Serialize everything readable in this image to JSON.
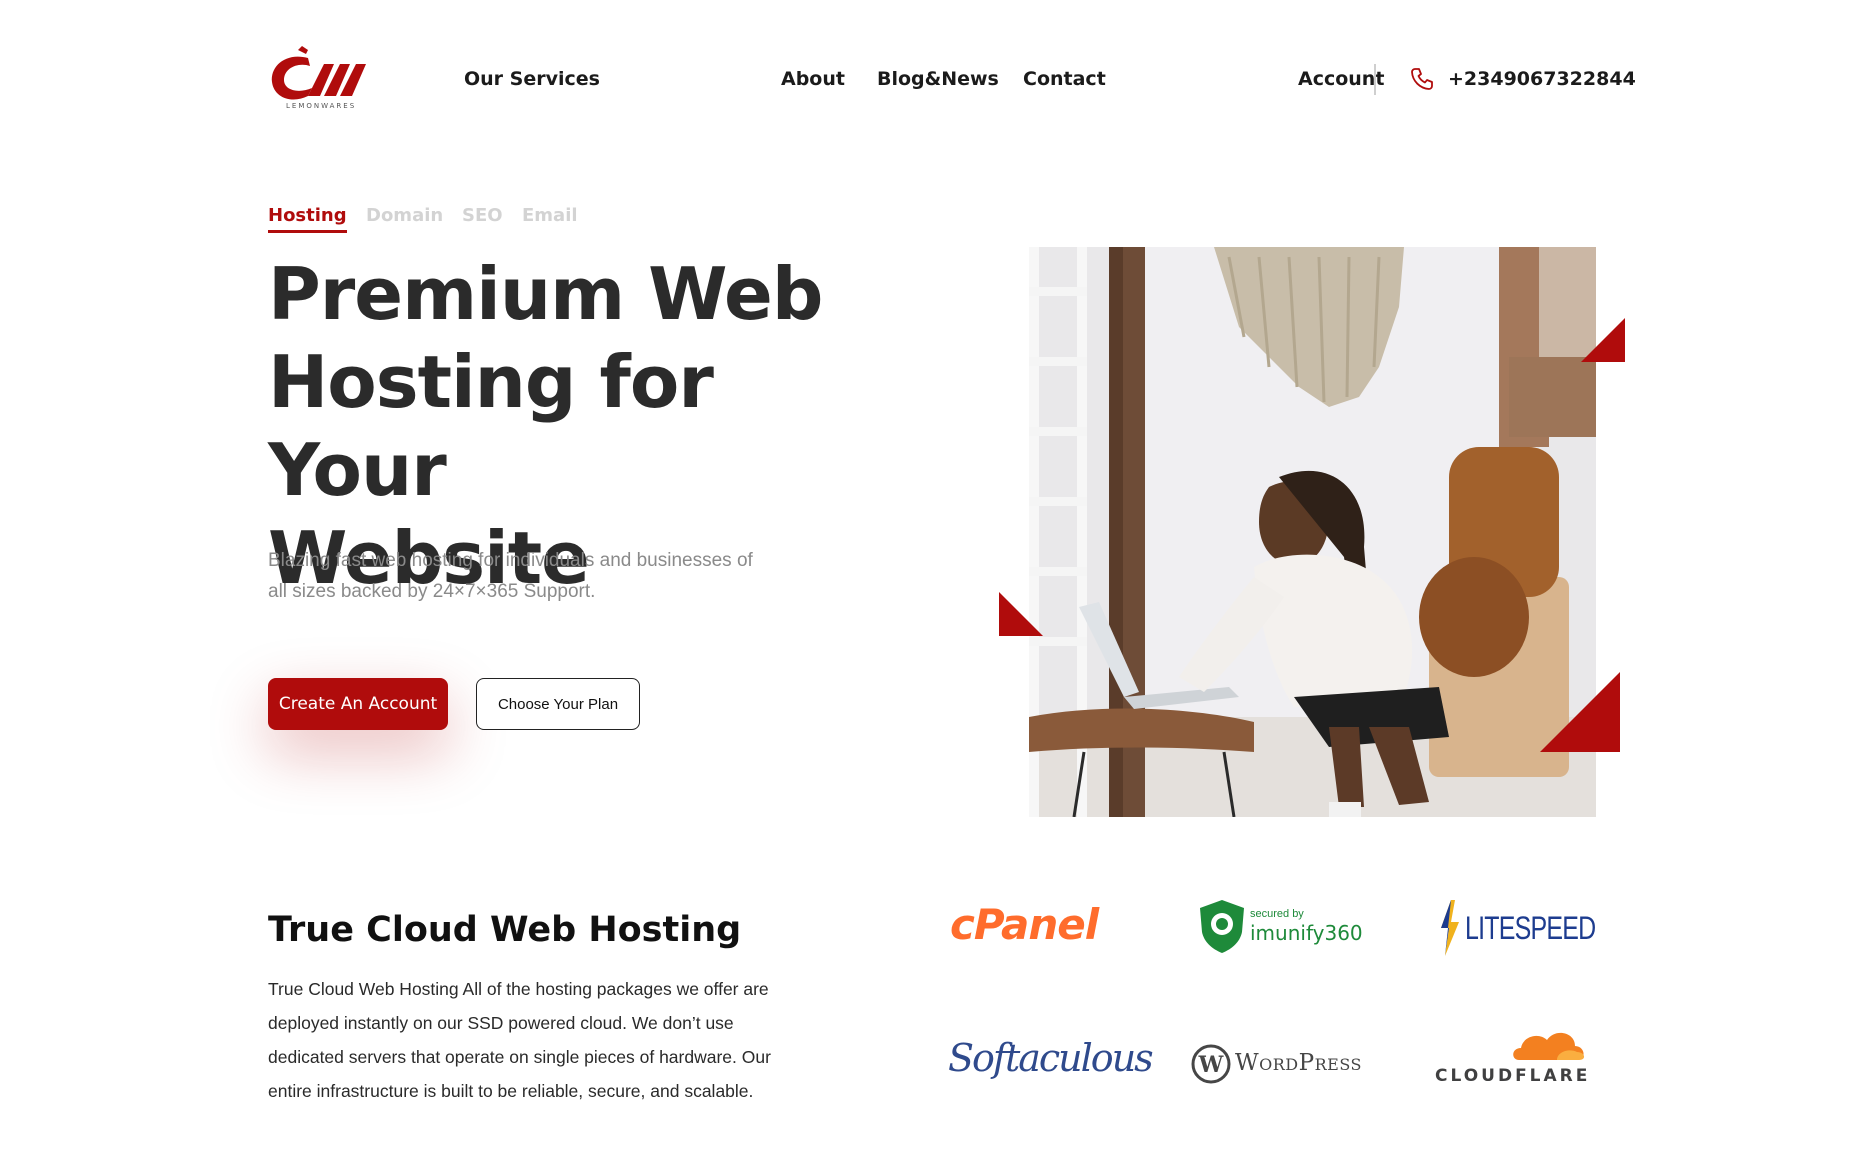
{
  "header": {
    "logo_text": "LEMONWARES",
    "nav": {
      "services": "Our Services",
      "about": "About",
      "blog": "Blog&News",
      "contact": "Contact",
      "account": "Account",
      "phone": "+2349067322844"
    }
  },
  "tabs": [
    {
      "label": "Hosting",
      "active": true
    },
    {
      "label": "Domain",
      "active": false
    },
    {
      "label": "SEO",
      "active": false
    },
    {
      "label": "Email",
      "active": false
    }
  ],
  "hero": {
    "title_line1": "Premium Web",
    "title_line2": "Hosting for Your",
    "title_line3": "Website",
    "subtitle_line1": "Blazing fast web hosting for individuals and businesses of",
    "subtitle_line2": "all sizes backed by 24×7×365 Support.",
    "primary_button": "Create An Account",
    "secondary_button": "Choose Your Plan"
  },
  "cloud_section": {
    "title": "True Cloud Web Hosting",
    "body_line1": "True Cloud Web Hosting All of the hosting packages we offer are",
    "body_line2": "deployed instantly on our SSD powered cloud. We don’t use",
    "body_line3": "dedicated servers that operate on single pieces of hardware. Our",
    "body_line4": "entire infrastructure is built to be reliable, secure, and scalable."
  },
  "partners": {
    "cpanel": "cPanel",
    "imunify_small": "secured by",
    "imunify": "imunify360",
    "litespeed": "LITESPEED",
    "softaculous": "Softaculous",
    "wordpress": "WordPress",
    "cloudflare": "CLOUDFLARE"
  },
  "colors": {
    "brand_red": "#b00c0c",
    "text_dark": "#2b2b2b",
    "text_muted": "#8a8a8a",
    "tab_inactive": "#d3d3d3",
    "cpanel_orange": "#ff6c2c",
    "imunify_green": "#1e8a3a",
    "litespeed_blue": "#1d3c8f",
    "softaculous_blue": "#2f4a8c",
    "cloudflare_orange": "#f38020"
  },
  "icons": {
    "logo": "lemonwares-logo",
    "phone": "phone-icon"
  }
}
